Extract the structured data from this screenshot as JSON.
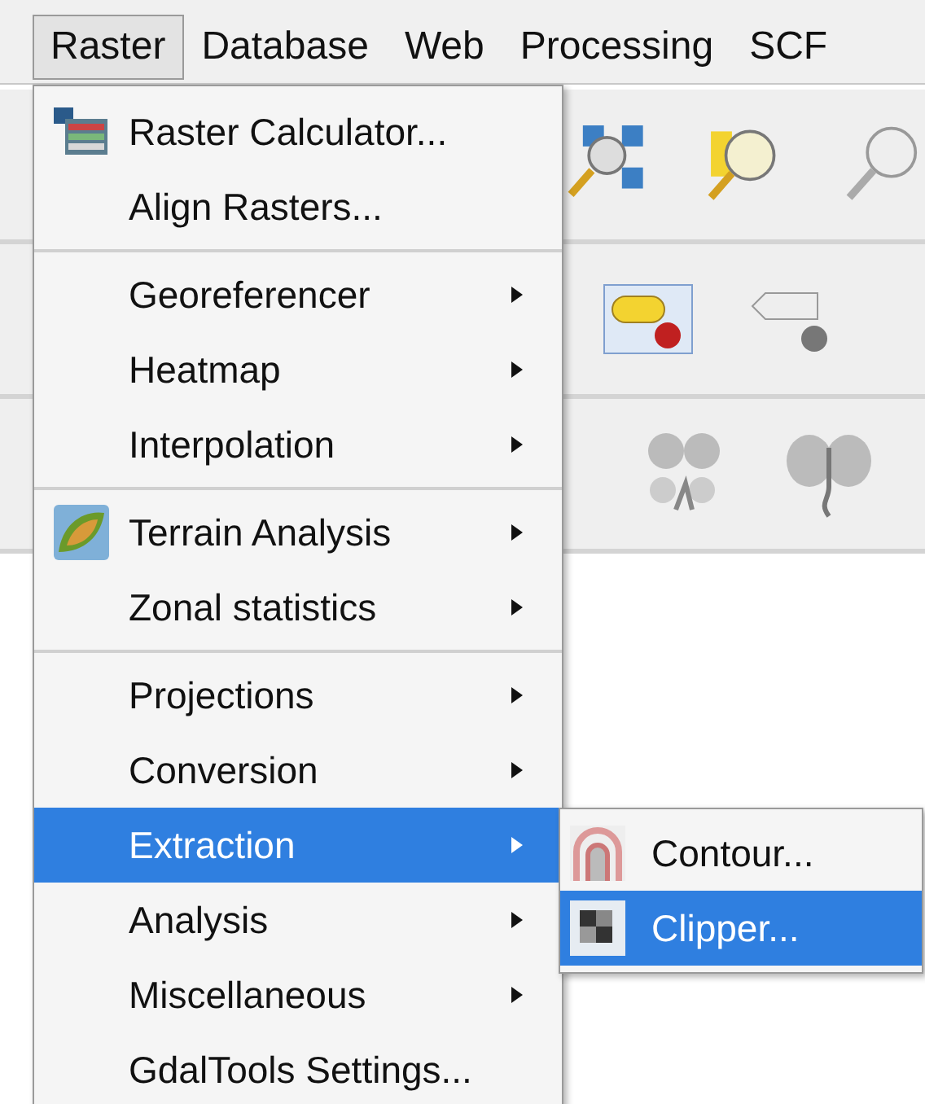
{
  "menubar": [
    {
      "label": "Raster",
      "selected": true
    },
    {
      "label": "Database",
      "selected": false
    },
    {
      "label": "Web",
      "selected": false
    },
    {
      "label": "Processing",
      "selected": false
    },
    {
      "label": "SCF",
      "selected": false
    }
  ],
  "menu": [
    {
      "kind": "item",
      "label": "Raster Calculator...",
      "submenu": false,
      "selected": false
    },
    {
      "kind": "item",
      "label": "Align Rasters...",
      "submenu": false,
      "selected": false
    },
    {
      "kind": "separator"
    },
    {
      "kind": "item",
      "label": "Georeferencer",
      "submenu": true,
      "selected": false
    },
    {
      "kind": "item",
      "label": "Heatmap",
      "submenu": true,
      "selected": false
    },
    {
      "kind": "item",
      "label": "Interpolation",
      "submenu": true,
      "selected": false
    },
    {
      "kind": "separator"
    },
    {
      "kind": "item",
      "label": "Terrain Analysis",
      "submenu": true,
      "selected": false
    },
    {
      "kind": "item",
      "label": "Zonal statistics",
      "submenu": true,
      "selected": false
    },
    {
      "kind": "separator"
    },
    {
      "kind": "item",
      "label": "Projections",
      "submenu": true,
      "selected": false
    },
    {
      "kind": "item",
      "label": "Conversion",
      "submenu": true,
      "selected": false
    },
    {
      "kind": "item",
      "label": "Extraction",
      "submenu": true,
      "selected": true
    },
    {
      "kind": "item",
      "label": "Analysis",
      "submenu": true,
      "selected": false
    },
    {
      "kind": "item",
      "label": "Miscellaneous",
      "submenu": true,
      "selected": false
    },
    {
      "kind": "item",
      "label": "GdalTools Settings...",
      "submenu": false,
      "selected": false
    }
  ],
  "submenu": [
    {
      "label": "Contour...",
      "selected": false
    },
    {
      "label": "Clipper...",
      "selected": true
    }
  ]
}
